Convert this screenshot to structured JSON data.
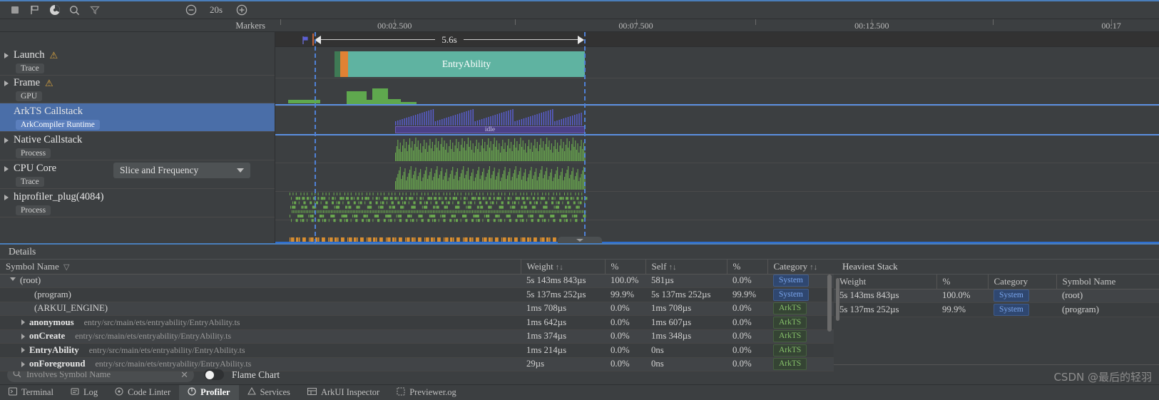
{
  "toolbar": {
    "icons": [
      {
        "name": "stop-icon",
        "glyph": "stop"
      },
      {
        "name": "flag-icon",
        "glyph": "flag"
      },
      {
        "name": "record-icon",
        "glyph": "record"
      },
      {
        "name": "search-icon",
        "glyph": "search"
      },
      {
        "name": "filter-icon",
        "glyph": "filter"
      }
    ],
    "zoom_out_label": "−",
    "zoom_level": "20s",
    "zoom_in_label": "+"
  },
  "markers": {
    "label": "Markers"
  },
  "ruler": {
    "ticks": [
      {
        "label": "00:02.500",
        "pos": 13.5
      },
      {
        "label": "00:07.500",
        "pos": 40.8
      },
      {
        "label": "00:12.500",
        "pos": 67.5
      },
      {
        "label": "00:17",
        "pos": 94.6
      }
    ]
  },
  "selection": {
    "duration": "5.6s"
  },
  "tracks": [
    {
      "name": "launch",
      "title": "Launch",
      "chip": "Trace",
      "warning": true,
      "expandable": true,
      "selected": false
    },
    {
      "name": "frame",
      "title": "Frame",
      "chip": "GPU",
      "warning": true,
      "expandable": true,
      "selected": false
    },
    {
      "name": "arkts-callstack",
      "title": "ArkTS Callstack",
      "chip": "ArkCompiler Runtime",
      "warning": false,
      "expandable": false,
      "selected": true
    },
    {
      "name": "native-callstack",
      "title": "Native Callstack",
      "chip": "Process",
      "warning": false,
      "expandable": true,
      "selected": false
    },
    {
      "name": "cpu-core",
      "title": "CPU Core",
      "chip": "Trace",
      "warning": false,
      "expandable": true,
      "selected": false,
      "dropdown": "Slice and Frequency"
    },
    {
      "name": "hiprofiler-plug",
      "title": "hiprofiler_plug(4084)",
      "chip": "Process",
      "warning": false,
      "expandable": true,
      "selected": false
    }
  ],
  "timeline_blocks": {
    "entry_ability_label": "EntryAbility",
    "idle_label": "idle"
  },
  "details": {
    "title": "Details",
    "columns": [
      "Symbol Name",
      "Weight",
      "%",
      "Self",
      "%",
      "Category"
    ],
    "rows": [
      {
        "symbol": "(root)",
        "file": "",
        "weight": "5s 143ms 843µs",
        "pct": "100.0%",
        "self": "581µs",
        "self_pct": "0.0%",
        "category": "System",
        "cat_class": "system",
        "indent": 0,
        "expander": "down",
        "bold": false
      },
      {
        "symbol": "(program)",
        "file": "",
        "weight": "5s 137ms 252µs",
        "pct": "99.9%",
        "self": "5s 137ms 252µs",
        "self_pct": "99.9%",
        "category": "System",
        "cat_class": "system",
        "indent": 1,
        "expander": "none",
        "bold": false
      },
      {
        "symbol": "(ARKUI_ENGINE)",
        "file": "",
        "weight": "1ms 708µs",
        "pct": "0.0%",
        "self": "1ms 708µs",
        "self_pct": "0.0%",
        "category": "ArkTS",
        "cat_class": "arkts",
        "indent": 1,
        "expander": "none",
        "bold": false
      },
      {
        "symbol": "anonymous",
        "file": "entry/src/main/ets/entryability/EntryAbility.ts",
        "weight": "1ms 642µs",
        "pct": "0.0%",
        "self": "1ms 607µs",
        "self_pct": "0.0%",
        "category": "ArkTS",
        "cat_class": "arkts",
        "indent": 1,
        "expander": "right",
        "bold": true
      },
      {
        "symbol": "onCreate",
        "file": "entry/src/main/ets/entryability/EntryAbility.ts",
        "weight": "1ms 374µs",
        "pct": "0.0%",
        "self": "1ms 348µs",
        "self_pct": "0.0%",
        "category": "ArkTS",
        "cat_class": "arkts",
        "indent": 1,
        "expander": "right",
        "bold": true
      },
      {
        "symbol": "EntryAbility",
        "file": "entry/src/main/ets/entryability/EntryAbility.ts",
        "weight": "1ms 214µs",
        "pct": "0.0%",
        "self": "0ns",
        "self_pct": "0.0%",
        "category": "ArkTS",
        "cat_class": "arkts",
        "indent": 1,
        "expander": "right",
        "bold": true
      },
      {
        "symbol": "onForeground",
        "file": "entry/src/main/ets/entryability/EntryAbility.ts",
        "weight": "29µs",
        "pct": "0.0%",
        "self": "0ns",
        "self_pct": "0.0%",
        "category": "ArkTS",
        "cat_class": "arkts",
        "indent": 1,
        "expander": "right",
        "bold": true
      }
    ]
  },
  "heaviest_stack": {
    "title": "Heaviest Stack",
    "columns": [
      "Weight",
      "%",
      "Category",
      "Symbol Name"
    ],
    "rows": [
      {
        "weight": "5s 143ms 843µs",
        "pct": "100.0%",
        "category": "System",
        "cat_class": "system",
        "symbol": "(root)"
      },
      {
        "weight": "5s 137ms 252µs",
        "pct": "99.9%",
        "category": "System",
        "cat_class": "system",
        "symbol": "(program)"
      }
    ]
  },
  "search": {
    "placeholder": "Involves Symbol Name",
    "value": "",
    "clear_label": "✕",
    "flame_chart_label": "Flame Chart"
  },
  "statusbar": {
    "items": [
      {
        "name": "terminal",
        "label": "Terminal",
        "icon": "terminal-icon",
        "active": false
      },
      {
        "name": "log",
        "label": "Log",
        "icon": "log-icon",
        "active": false
      },
      {
        "name": "code-linter",
        "label": "Code Linter",
        "icon": "linter-icon",
        "active": false
      },
      {
        "name": "profiler",
        "label": "Profiler",
        "icon": "profiler-icon",
        "active": true
      },
      {
        "name": "services",
        "label": "Services",
        "icon": "services-icon",
        "active": false
      },
      {
        "name": "arkui-inspector",
        "label": "ArkUI Inspector",
        "icon": "inspector-icon",
        "active": false
      },
      {
        "name": "previewer-log",
        "label": "Previewer.og",
        "icon": "previewer-icon",
        "active": false
      }
    ]
  },
  "watermark": {
    "text": "CSDN @最后的轻羽"
  },
  "colors": {
    "accent": "#4a7ebb",
    "selection": "#4a6ea8",
    "entry_ability": "#5fb3a1",
    "frame_green": "#5fa84e",
    "callstack_blue": "#5b5fd6",
    "system_badge": "#7ba7ef",
    "arkts_badge": "#86c06a",
    "minimap_orange": "#d98e30"
  }
}
